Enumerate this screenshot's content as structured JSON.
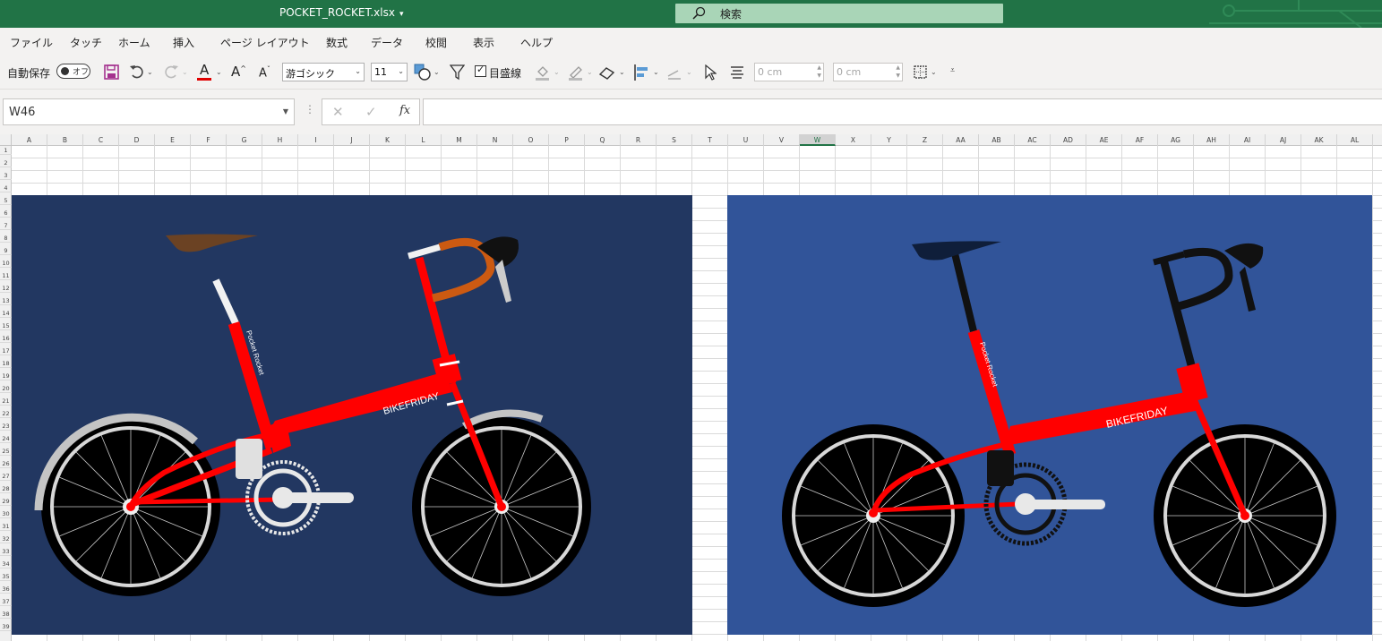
{
  "title_bar": {
    "filename": "POCKET_ROCKET.xlsx",
    "search_label": "検索"
  },
  "menu": {
    "items": [
      "ファイル",
      "タッチ",
      "ホーム",
      "挿入",
      "ページ レイアウト",
      "数式",
      "データ",
      "校閲",
      "表示",
      "ヘルプ"
    ]
  },
  "ribbon": {
    "autosave_label": "自動保存",
    "autosave_state": "オフ",
    "font_name": "游ゴシック",
    "font_size": "11",
    "gridlines_label": "目盛線",
    "width_value": "0 cm",
    "height_value": "0 cm"
  },
  "formula_bar": {
    "name_box": "W46",
    "cancel_glyph": "✕",
    "enter_glyph": "✓",
    "fx_label": "fx",
    "formula": ""
  },
  "sheet": {
    "columns": [
      "A",
      "B",
      "C",
      "D",
      "E",
      "F",
      "G",
      "H",
      "I",
      "J",
      "K",
      "L",
      "M",
      "N",
      "O",
      "P",
      "Q",
      "R",
      "S",
      "T",
      "U",
      "V",
      "W",
      "X",
      "Y",
      "Z",
      "AA",
      "AB",
      "AC",
      "AD",
      "AE",
      "AF",
      "AG",
      "AH",
      "AI",
      "AJ",
      "AK",
      "AL"
    ],
    "selected_column": "W",
    "rows": [
      "1",
      "2",
      "3",
      "4",
      "5",
      "6",
      "7",
      "8",
      "9",
      "10",
      "11",
      "12",
      "13",
      "14",
      "15",
      "16",
      "17",
      "18",
      "19",
      "20",
      "21",
      "22",
      "23",
      "24",
      "25",
      "26",
      "27",
      "28",
      "29",
      "30",
      "31",
      "32",
      "33",
      "34",
      "35",
      "36",
      "37",
      "38",
      "39"
    ]
  },
  "artwork": {
    "seat_tube_text": "Pocket Rocket",
    "down_tube_text": "BIKEFRIDAY",
    "left_background": "#223761",
    "right_background": "#315499",
    "frame_color": "#ff0000"
  },
  "colors": {
    "excel_green": "#217346",
    "ribbon_bg": "#f3f2f1"
  }
}
